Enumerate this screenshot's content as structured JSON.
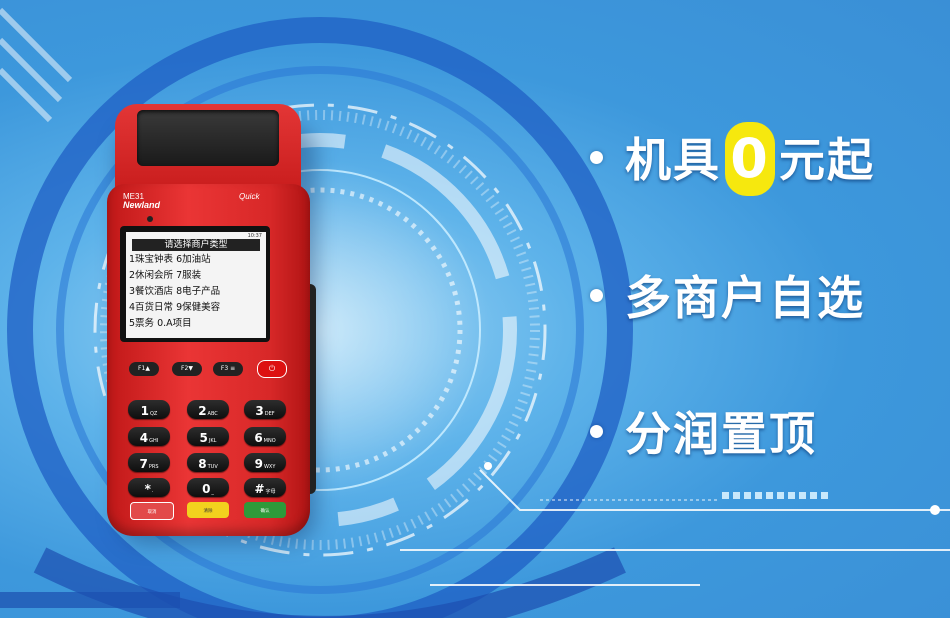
{
  "pos": {
    "model": "ME31",
    "brand": "Newland",
    "quick": "Quick",
    "status_time": "10:37",
    "screen_title": "请选择商户类型",
    "screen_rows": [
      "1珠宝钟表 6加油站",
      "2休闲会所 7服装",
      "3餐饮酒店 8电子产品",
      "4百货日常 9保健美容",
      "5票务      0.A项目"
    ],
    "fkeys": [
      "F1▲",
      "F2▼",
      "F3 ≡"
    ],
    "power_icon": "power-icon",
    "keys": [
      {
        "n": "1",
        "l": "QZ"
      },
      {
        "n": "2",
        "l": "ABC"
      },
      {
        "n": "3",
        "l": "DEF"
      },
      {
        "n": "4",
        "l": "GHI"
      },
      {
        "n": "5",
        "l": "JKL"
      },
      {
        "n": "6",
        "l": "MNO"
      },
      {
        "n": "7",
        "l": "PRS"
      },
      {
        "n": "8",
        "l": "TUV"
      },
      {
        "n": "9",
        "l": "WXY"
      },
      {
        "n": "*",
        "l": "·"
      },
      {
        "n": "0",
        "l": "_"
      },
      {
        "n": "#",
        "l": "字母"
      }
    ],
    "soft_keys": [
      "取消",
      "清除",
      "确认"
    ]
  },
  "features": {
    "line1_before": "机具",
    "line1_zero": "0",
    "line1_after": "元起",
    "line2": "多商户自选",
    "line3": "分润置顶"
  },
  "colors": {
    "background": "#3d98dc",
    "device": "#e02828",
    "accent": "#f6e80e"
  }
}
